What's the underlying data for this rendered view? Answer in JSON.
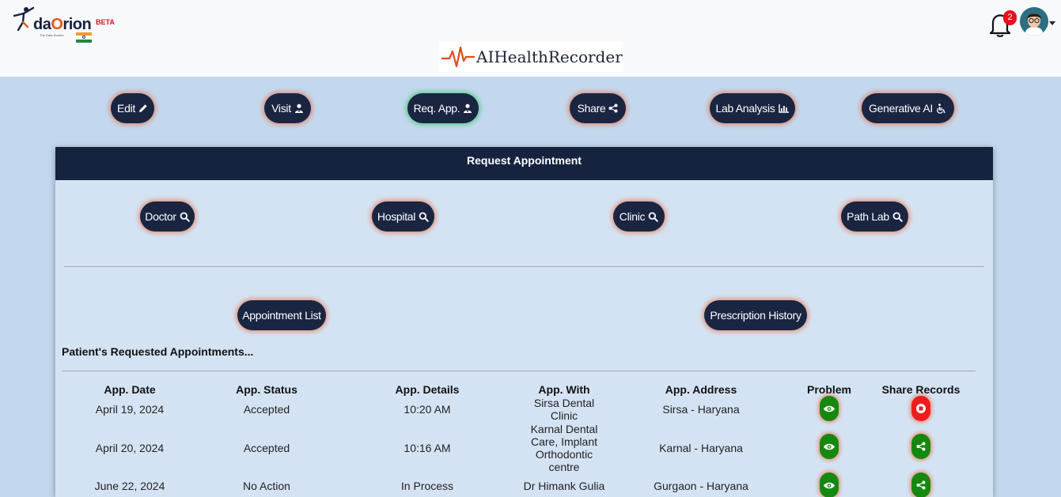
{
  "header": {
    "logo_text_prefix": "da",
    "logo_text_o": "O",
    "logo_text_suffix": "rion",
    "logo_tagline": "The Data Rooted",
    "beta": "BETA",
    "brand": "AIHealthRecorder",
    "notification_count": "2"
  },
  "nav": [
    {
      "label": "Edit",
      "icon": "pencil-icon"
    },
    {
      "label": "Visit",
      "icon": "user-doctor-icon"
    },
    {
      "label": "Req. App.",
      "icon": "user-doctor-icon"
    },
    {
      "label": "Share",
      "icon": "share-icon"
    },
    {
      "label": "Lab Analysis",
      "icon": "bar-chart-icon"
    },
    {
      "label": "Generative AI",
      "icon": "wheelchair-icon"
    }
  ],
  "panel": {
    "title": "Request Appointment",
    "search_buttons": [
      "Doctor",
      "Hospital",
      "Clinic",
      "Path Lab"
    ],
    "list_buttons": [
      "Appointment List",
      "Prescription History"
    ],
    "section_title": "Patient's Requested Appointments..."
  },
  "table": {
    "headers": [
      "App. Date",
      "App. Status",
      "App. Details",
      "App. With",
      "App. Address",
      "Problem",
      "Share Records"
    ],
    "rows": [
      {
        "date": "April 19, 2024",
        "status": "Accepted",
        "details": "10:20 AM",
        "with": "Sirsa Dental Clinic",
        "address": "Sirsa - Haryana",
        "share": "stop"
      },
      {
        "date": "April 20, 2024",
        "status": "Accepted",
        "details": "10:16 AM",
        "with": "Karnal Dental Care, Implant Orthodontic centre",
        "address": "Karnal - Haryana",
        "share": "share"
      },
      {
        "date": "June 22, 2024",
        "status": "No Action",
        "details": "In Process",
        "with": "Dr Himank Gulia",
        "address": "Gurgaon - Haryana",
        "share": "share"
      }
    ]
  },
  "colors": {
    "nav_bg": "#1a2542",
    "panel_header": "#15233f",
    "accent_glow": "#e87850",
    "active_glow": "#46c878",
    "green": "#15880f",
    "red": "#ee1c1c"
  }
}
